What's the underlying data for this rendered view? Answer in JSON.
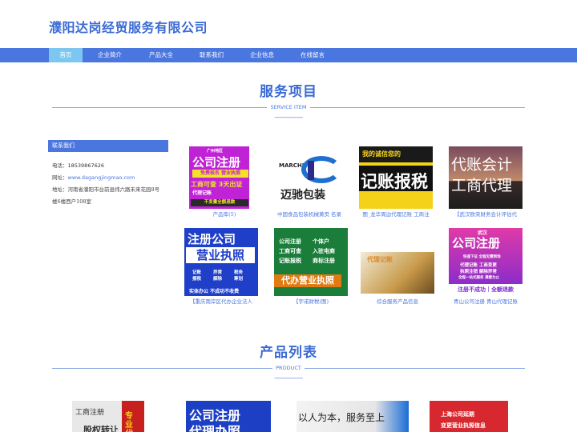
{
  "site": {
    "title": "濮阳达岗经贸服务有限公司"
  },
  "nav": {
    "items": [
      "首页",
      "企业简介",
      "产品大全",
      "联系我们",
      "企业信息",
      "在线留言"
    ]
  },
  "services_section": {
    "title": "服务项目",
    "subtitle": "SERVICE ITEM",
    "dash": "----------------"
  },
  "products_section": {
    "title": "产品列表",
    "subtitle": "PRODUCT",
    "dash": "----------------"
  },
  "contact": {
    "heading": "联系我们",
    "phone_label": "电话：",
    "phone": "18539867626",
    "web_label": "网址：",
    "web": "www.dagangjingmao.com",
    "addr_label": "地址：",
    "addr": "河南省濮阳市台前县纬六路未来花园8号楼6楼西户108室"
  },
  "services": [
    {
      "caption": "产品库(5)",
      "lines": [
        "广州地区",
        "公司注册",
        "免费核名  营业执照",
        "工商可查  3天出证",
        "代理记账",
        "不变量全额退款"
      ]
    },
    {
      "caption": "中国食品包装机械黄页 名录",
      "lines": [
        "MARCHI",
        "迈驰包装"
      ]
    },
    {
      "caption": "图_龙华周边代理记账 工商注",
      "lines": [
        "我的诚信您的",
        "记账报税"
      ]
    },
    {
      "caption": "【武汉欧荣财务会计评估代",
      "lines": [
        "代账会计",
        "工商代理"
      ]
    },
    {
      "caption": "【重庆南岸区代办企业法人",
      "lines": [
        "注册公司",
        "营业执照",
        "记账 报税",
        "异常 解除",
        "税务 筹划",
        "实体办公 不成功不收费"
      ]
    },
    {
      "caption": "【宇诺财税(图)",
      "lines": [
        "个体户",
        "公司注册",
        "工商可查",
        "入驻电商",
        "记账报税",
        "商标注册",
        "代办营业执照"
      ]
    },
    {
      "caption": "综合服务产品信息",
      "lines": [
        "代理记账"
      ]
    },
    {
      "caption": "青山公司注册 青山代理记账",
      "lines": [
        "武汉",
        "公司注册",
        "快速下证 全程无需到场",
        "代理记账  工商变更",
        "执照注销  解除异常",
        "全程一站式服务 满意为止",
        "注册不成功｜全额退款"
      ]
    }
  ],
  "products": [
    {
      "lines": [
        "工商注册",
        "专业代",
        "股权转让"
      ]
    },
    {
      "lines": [
        "公司注册",
        "代理办照"
      ]
    },
    {
      "lines": [
        "以人为本，服务至上"
      ]
    },
    {
      "lines": [
        "上海公司延期",
        "变更营业执照信息"
      ]
    }
  ]
}
